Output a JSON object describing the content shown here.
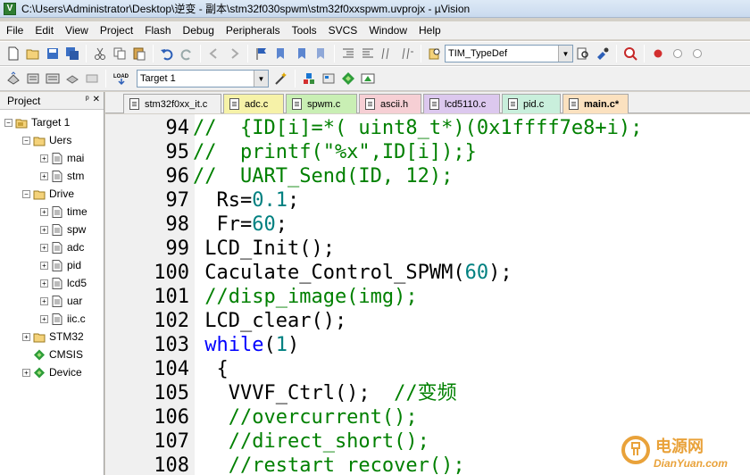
{
  "window": {
    "title": "C:\\Users\\Administrator\\Desktop\\逆变 - 副本\\stm32f030spwm\\stm32f0xxspwm.uvprojx - µVision"
  },
  "menu": [
    "File",
    "Edit",
    "View",
    "Project",
    "Flash",
    "Debug",
    "Peripherals",
    "Tools",
    "SVCS",
    "Window",
    "Help"
  ],
  "toolbar": {
    "find_combo_value": "TIM_TypeDef",
    "target_combo_value": "Target 1",
    "load_label": "LOAD"
  },
  "project": {
    "header": "Project",
    "pin_glyph": "ᵖ",
    "close_glyph": "✕",
    "tree": [
      {
        "label": "Target 1",
        "level": 0,
        "expander": "−",
        "kind": "target"
      },
      {
        "label": "Uers",
        "level": 1,
        "expander": "−",
        "kind": "folder"
      },
      {
        "label": "mai",
        "level": 2,
        "expander": "+",
        "kind": "file"
      },
      {
        "label": "stm",
        "level": 2,
        "expander": "+",
        "kind": "file"
      },
      {
        "label": "Drive",
        "level": 1,
        "expander": "−",
        "kind": "folder"
      },
      {
        "label": "time",
        "level": 2,
        "expander": "+",
        "kind": "file"
      },
      {
        "label": "spw",
        "level": 2,
        "expander": "+",
        "kind": "file"
      },
      {
        "label": "adc",
        "level": 2,
        "expander": "+",
        "kind": "file"
      },
      {
        "label": "pid",
        "level": 2,
        "expander": "+",
        "kind": "file"
      },
      {
        "label": "lcd5",
        "level": 2,
        "expander": "+",
        "kind": "file"
      },
      {
        "label": "uar",
        "level": 2,
        "expander": "+",
        "kind": "file"
      },
      {
        "label": "iic.c",
        "level": 2,
        "expander": "+",
        "kind": "file"
      },
      {
        "label": "STM32",
        "level": 1,
        "expander": "+",
        "kind": "folder"
      },
      {
        "label": "CMSIS",
        "level": 1,
        "expander": "",
        "kind": "diamond"
      },
      {
        "label": "Device",
        "level": 1,
        "expander": "+",
        "kind": "diamond"
      }
    ]
  },
  "tabs": [
    {
      "label": "stm32f0xx_it.c",
      "color": "#f0f0f0",
      "active": false
    },
    {
      "label": "adc.c",
      "color": "#f6f2a8",
      "active": false
    },
    {
      "label": "spwm.c",
      "color": "#c9efb4",
      "active": false
    },
    {
      "label": "ascii.h",
      "color": "#f6cfd4",
      "active": false
    },
    {
      "label": "lcd5110.c",
      "color": "#dcc8ee",
      "active": false
    },
    {
      "label": "pid.c",
      "color": "#c9efdc",
      "active": false
    },
    {
      "label": "main.c*",
      "color": "#fbe1bf",
      "active": true
    }
  ],
  "code_lines": [
    {
      "n": "94",
      "segs": [
        {
          "t": "//  {ID[i]=*( uint8_t*)(0x1ffff7e8+i);",
          "c": "cm"
        }
      ]
    },
    {
      "n": "95",
      "segs": [
        {
          "t": "//  printf(\"%x\",ID[i]);}",
          "c": "cm"
        }
      ]
    },
    {
      "n": "96",
      "segs": [
        {
          "t": "//  UART_Send(ID, 12);",
          "c": "cm"
        }
      ]
    },
    {
      "n": "97",
      "segs": [
        {
          "t": "  Rs=",
          "c": "pl"
        },
        {
          "t": "0.1",
          "c": "num"
        },
        {
          "t": ";",
          "c": "pl"
        }
      ]
    },
    {
      "n": "98",
      "segs": [
        {
          "t": "  Fr=",
          "c": "pl"
        },
        {
          "t": "60",
          "c": "num"
        },
        {
          "t": ";",
          "c": "pl"
        }
      ]
    },
    {
      "n": "99",
      "segs": [
        {
          "t": " LCD_Init();",
          "c": "pl"
        }
      ]
    },
    {
      "n": "100",
      "segs": [
        {
          "t": " Caculate_Control_SPWM(",
          "c": "pl"
        },
        {
          "t": "60",
          "c": "num"
        },
        {
          "t": ");",
          "c": "pl"
        }
      ]
    },
    {
      "n": "101",
      "segs": [
        {
          "t": " //disp_image(img);",
          "c": "cm"
        }
      ]
    },
    {
      "n": "102",
      "segs": [
        {
          "t": " LCD_clear();",
          "c": "pl"
        }
      ]
    },
    {
      "n": "103",
      "segs": [
        {
          "t": " ",
          "c": "pl"
        },
        {
          "t": "while",
          "c": "kw"
        },
        {
          "t": "(",
          "c": "pl"
        },
        {
          "t": "1",
          "c": "num"
        },
        {
          "t": ")",
          "c": "pl"
        }
      ]
    },
    {
      "n": "104",
      "segs": [
        {
          "t": "  {",
          "c": "pl"
        }
      ]
    },
    {
      "n": "105",
      "segs": [
        {
          "t": "   VVVF_Ctrl();  ",
          "c": "pl"
        },
        {
          "t": "//变频",
          "c": "cm"
        }
      ]
    },
    {
      "n": "106",
      "segs": [
        {
          "t": "   //overcurrent();",
          "c": "cm"
        }
      ]
    },
    {
      "n": "107",
      "segs": [
        {
          "t": "   //direct_short();",
          "c": "cm"
        }
      ]
    },
    {
      "n": "108",
      "segs": [
        {
          "t": "   //restart_recover();",
          "c": "cm"
        }
      ]
    }
  ],
  "watermark": {
    "brand": "电源网",
    "site": "DianYuan.com"
  },
  "colors": {
    "comment": "#008000",
    "keyword": "#0000ff",
    "number": "#008080",
    "watermark": "#e9a23a"
  }
}
